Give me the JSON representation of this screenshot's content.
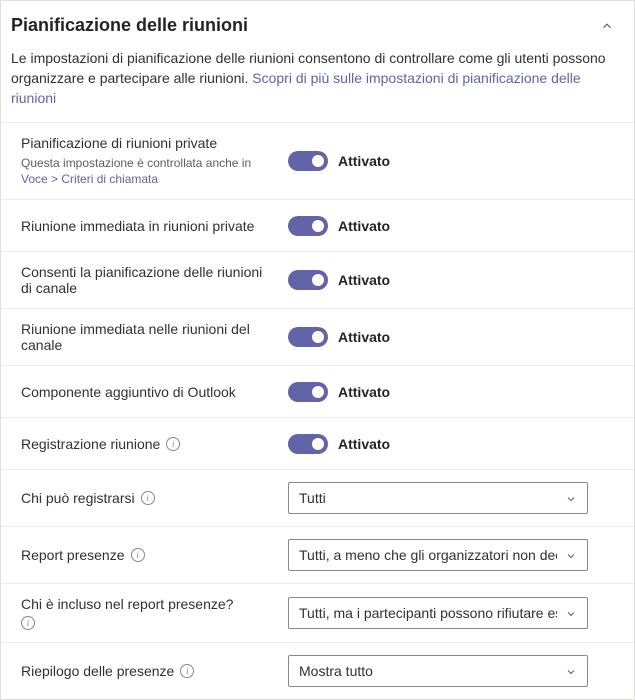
{
  "header": {
    "title": "Pianificazione delle riunioni"
  },
  "intro": {
    "text": "Le impostazioni di pianificazione delle riunioni consentono di controllare come gli utenti possono organizzare e partecipare alle riunioni. ",
    "link": "Scopri di più sulle impostazioni di pianificazione delle riunioni"
  },
  "rows": {
    "private_scheduling": {
      "label": "Pianificazione di riunioni private",
      "sub_pre": "Questa impostazione è controllata anche in ",
      "sub_link": "Voce > Criteri di chiamata",
      "toggle": "Attivato"
    },
    "meet_now_private": {
      "label": "Riunione immediata in riunioni private",
      "toggle": "Attivato"
    },
    "channel_scheduling": {
      "label": "Consenti la pianificazione delle riunioni di canale",
      "toggle": "Attivato"
    },
    "meet_now_channel": {
      "label": "Riunione immediata nelle riunioni del canale",
      "toggle": "Attivato"
    },
    "outlook_addin": {
      "label": "Componente aggiuntivo di Outlook",
      "toggle": "Attivato"
    },
    "registration": {
      "label": "Registrazione riunione",
      "toggle": "Attivato"
    },
    "who_register": {
      "label": "Chi può registrarsi",
      "value": "Tutti"
    },
    "attendance_report": {
      "label": "Report presenze",
      "value": "Tutti, a meno che gli organizzatori non decid"
    },
    "who_in_report": {
      "label": "Chi è incluso nel report presenze?",
      "value": "Tutti, ma i partecipanti possono rifiutare esp"
    },
    "attendance_summary": {
      "label": "Riepilogo delle presenze",
      "value": "Mostra tutto"
    }
  }
}
